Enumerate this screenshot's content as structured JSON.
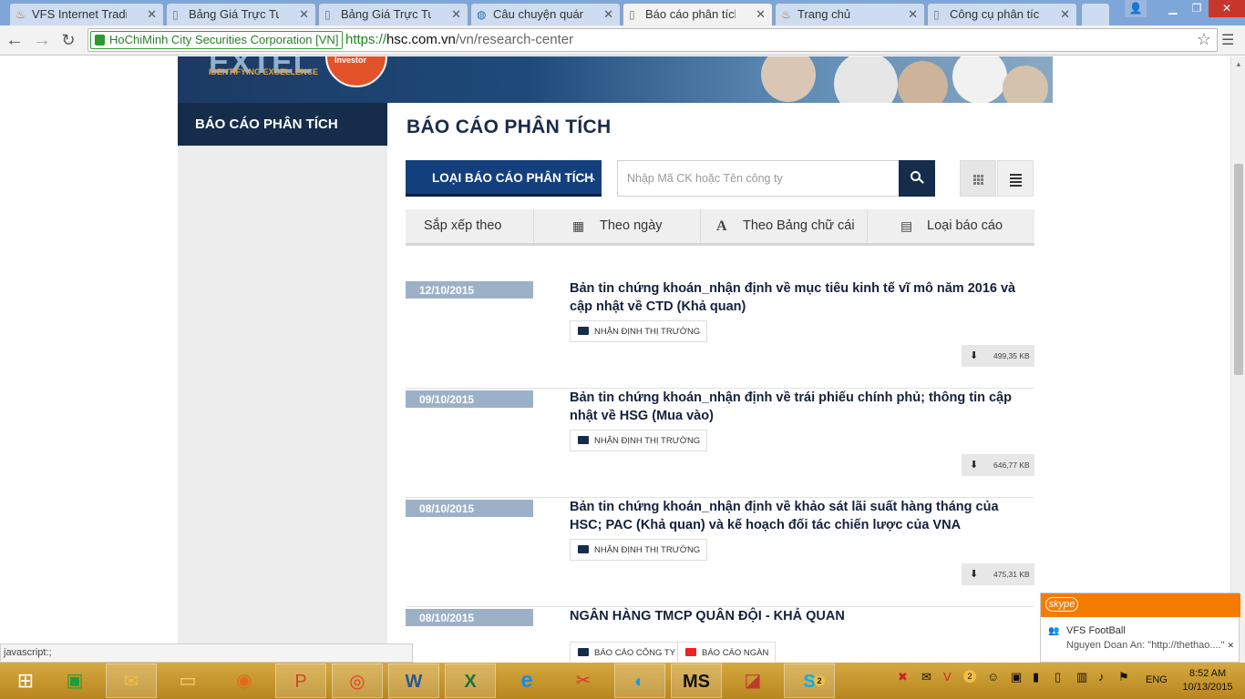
{
  "browser": {
    "tabs": [
      {
        "label": "VFS Internet Trading",
        "icon": "vfs-flame-icon"
      },
      {
        "label": "Bảng Giá Trực Tuyến",
        "icon": "page-icon"
      },
      {
        "label": "Bảng Giá Trực Tuyến",
        "icon": "page-icon"
      },
      {
        "label": "Câu chuyện quán ốc",
        "icon": "globe-icon"
      },
      {
        "label": "Báo cáo phân tích - H",
        "icon": "page-icon"
      },
      {
        "label": "Trang chủ",
        "icon": "vfs-flame-icon"
      },
      {
        "label": "Công cụ phân tích đã",
        "icon": "page-icon"
      }
    ],
    "active_tab": 4,
    "secure_label": "HoChiMinh City Securities Corporation [VN]",
    "url_protocol": "https://",
    "url_domain": "hsc.com.vn",
    "url_path": "/vn/research-center",
    "status_text": "javascript:;"
  },
  "banner": {
    "brand": "EXTEL",
    "brand_tagline": "IDENTIFYING EXCELLENCE",
    "badge_text": "Investor"
  },
  "sidebar": {
    "items": [
      {
        "label": "BÁO CÁO PHÂN TÍCH"
      }
    ]
  },
  "main": {
    "title": "BÁO CÁO PHÂN TÍCH",
    "report_type_button": "LOẠI BÁO CÁO PHÂN TÍCH",
    "search_placeholder": "Nhập Mã CK hoặc Tên công ty",
    "sort": {
      "label": "Sắp xếp theo",
      "options": [
        {
          "label": "Theo ngày",
          "icon": "calendar-icon"
        },
        {
          "label": "Theo Bảng chữ cái",
          "icon": "letter-a-icon"
        },
        {
          "label": "Loại báo cáo",
          "icon": "document-icon"
        }
      ]
    },
    "reports": [
      {
        "date": "12/10/2015",
        "title": "Bản tin chứng khoán_nhận định về mục tiêu kinh tế vĩ mô năm 2016 và cập nhật về CTD (Khả quan)",
        "tags": [
          "NHẬN ĐỊNH THỊ TRƯỜNG"
        ],
        "size": "499,35 KB"
      },
      {
        "date": "09/10/2015",
        "title": "Bản tin chứng khoán_nhận định về trái phiếu chính phủ; thông tin cập nhật về HSG (Mua vào)",
        "tags": [
          "NHẬN ĐỊNH THỊ TRƯỜNG"
        ],
        "size": "646,77 KB"
      },
      {
        "date": "08/10/2015",
        "title": "Bản tin chứng khoán_nhận định về khảo sát lãi suất hàng tháng của HSC; PAC (Khả quan) và kế hoạch đối tác chiến lược của VNA",
        "tags": [
          "NHẬN ĐỊNH THỊ TRƯỜNG"
        ],
        "size": "475,31 KB"
      },
      {
        "date": "08/10/2015",
        "title": "NGÂN HÀNG TMCP QUÂN ĐỘI - KHẢ QUAN",
        "tags": [
          "BÁO CÁO CÔNG TY",
          "BÁO CÁO NGÀN"
        ],
        "size": ""
      }
    ]
  },
  "skype": {
    "brand": "skype",
    "conversation": "VFS FootBall",
    "message": "Nguyen Doan An: \"http://thethao....\""
  },
  "taskbar": {
    "language": "ENG",
    "time": "8:52 AM",
    "date": "10/13/2015",
    "skype_badge": "2",
    "tray_badge": "2"
  },
  "colors": {
    "navy": "#152c4a",
    "button_blue": "#143f7d",
    "date_badge": "#9cb1c8",
    "skype_orange": "#f57c00",
    "taskbar_gold": "#c49528",
    "tab_blue": "#7fa6d8"
  }
}
